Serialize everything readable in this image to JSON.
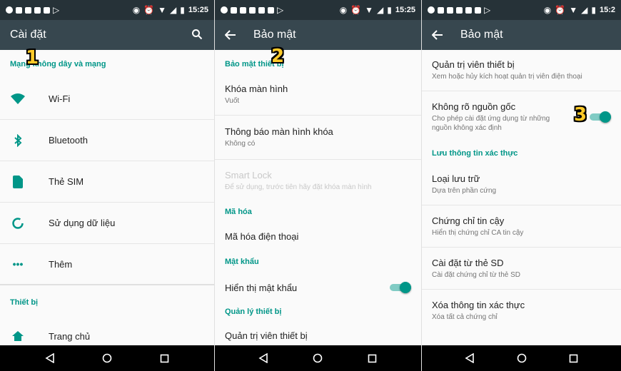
{
  "status": {
    "time": "15:25",
    "time_cut": "15:2"
  },
  "panel1": {
    "title": "Cài đặt",
    "section_wireless": "Mạng không dây và mạng",
    "items": [
      {
        "label": "Wi-Fi",
        "icon": "wifi-icon"
      },
      {
        "label": "Bluetooth",
        "icon": "bluetooth-icon"
      },
      {
        "label": "Thẻ SIM",
        "icon": "sim-card-icon"
      },
      {
        "label": "Sử dụng dữ liệu",
        "icon": "data-usage-icon"
      },
      {
        "label": "Thêm",
        "icon": "more-icon"
      }
    ],
    "section_device": "Thiết bị",
    "home_label": "Trang chủ"
  },
  "panel2": {
    "title": "Bảo mật",
    "section_device_security": "Bảo mật thiết bị",
    "screen_lock": {
      "title": "Khóa màn hình",
      "summary": "Vuốt"
    },
    "lock_notifications": {
      "title": "Thông báo màn hình khóa",
      "summary": "Không có"
    },
    "smart_lock": {
      "title": "Smart Lock",
      "summary": "Để sử dụng, trước tiên hãy đặt khóa màn hình"
    },
    "section_encryption": "Mã hóa",
    "encrypt_phone": "Mã hóa điện thoại",
    "section_password": "Mật khẩu",
    "show_password": "Hiển thị mật khẩu",
    "section_device_admin": "Quản lý thiết bị",
    "device_admins": "Quản trị viên thiết bị"
  },
  "panel3": {
    "title": "Bảo mật",
    "device_admins": {
      "title": "Quản trị viên thiết bị",
      "summary": "Xem hoặc hủy kích hoạt quản trị viên điện thoại"
    },
    "unknown_sources": {
      "title": "Không rõ nguồn gốc",
      "summary": "Cho phép cài đặt ứng dụng từ những nguồn không xác định"
    },
    "section_credentials": "Lưu thông tin xác thực",
    "storage_type": {
      "title": "Loại lưu trữ",
      "summary": "Dựa trên phần cứng"
    },
    "trusted_credentials": {
      "title": "Chứng chỉ tin cậy",
      "summary": "Hiển thị chứng chỉ CA tin cậy"
    },
    "install_from_sd": {
      "title": "Cài đặt từ thẻ SD",
      "summary": "Cài đặt chứng chỉ từ thẻ SD"
    },
    "clear_credentials": {
      "title": "Xóa thông tin xác thực",
      "summary": "Xóa tất cả chứng chỉ"
    }
  },
  "badges": {
    "one": "1",
    "two": "2",
    "three": "3"
  },
  "colors": {
    "accent": "#009688",
    "appbar": "#37474f",
    "statusbar": "#263238"
  }
}
